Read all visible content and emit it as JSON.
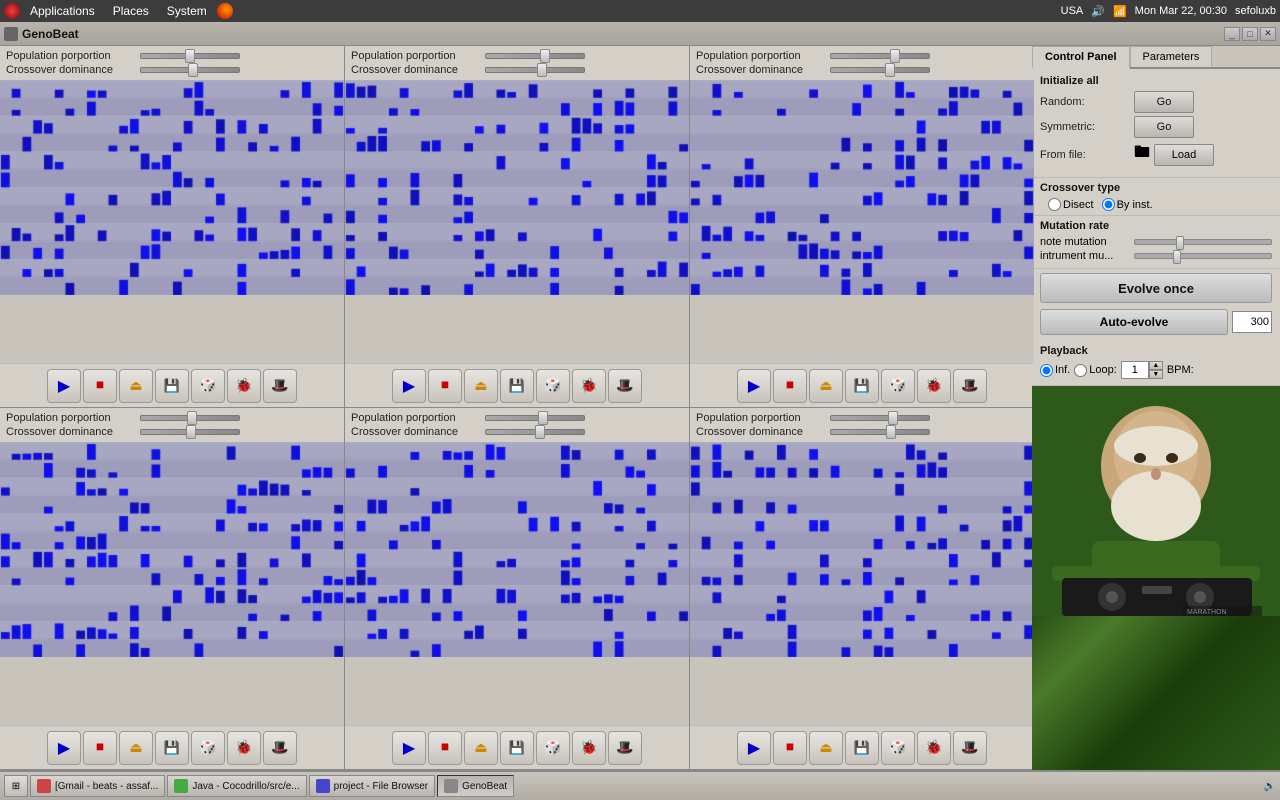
{
  "menubar": {
    "apps_label": "Applications",
    "places_label": "Places",
    "system_label": "System",
    "location": "USA",
    "time": "Mon Mar 22, 00:30",
    "user": "sefoluxb"
  },
  "titlebar": {
    "title": "GenoBeat"
  },
  "win_controls": {
    "minimize": "_",
    "maximize": "□",
    "close": "✕"
  },
  "panels": [
    {
      "id": 1
    },
    {
      "id": 2
    },
    {
      "id": 3
    },
    {
      "id": 4
    },
    {
      "id": 5
    },
    {
      "id": 6
    }
  ],
  "panel_controls": {
    "population_label": "Population porportion",
    "crossover_label": "Crossover dominance"
  },
  "toolbar_buttons": [
    {
      "name": "play",
      "icon": "▶"
    },
    {
      "name": "stop",
      "icon": "⏹"
    },
    {
      "name": "eject",
      "icon": "⏏"
    },
    {
      "name": "save",
      "icon": "💾"
    },
    {
      "name": "dice",
      "icon": "🎲"
    },
    {
      "name": "bug",
      "icon": "🐞"
    },
    {
      "name": "hat",
      "icon": "🎩"
    }
  ],
  "control_panel": {
    "tab1": "Control Panel",
    "tab2": "Parameters",
    "initialize_title": "Initialize all",
    "random_label": "Random:",
    "symmetric_label": "Symmetric:",
    "from_file_label": "From file:",
    "go_label": "Go",
    "load_label": "Load",
    "crossover_title": "Crossover type",
    "disect_label": "Disect",
    "by_inst_label": "By inst.",
    "mutation_title": "Mutation rate",
    "note_mutation_label": "note mutation",
    "instr_mutation_label": "intrument mu...",
    "evolve_once_label": "Evolve once",
    "auto_evolve_label": "Auto-evolve",
    "auto_evolve_val": "300",
    "playback_title": "Playback",
    "inf_label": "Inf.",
    "loop_label": "Loop:",
    "bpm_label": "BPM:",
    "playback_num": "1"
  },
  "taskbar": {
    "items": [
      {
        "label": "[Gmail - beats - assaf...",
        "icon_color": "#c44"
      },
      {
        "label": "Java - Cocodrillo/src/e...",
        "icon_color": "#4a4"
      },
      {
        "label": "project - File Browser",
        "icon_color": "#44c"
      },
      {
        "label": "GenoBeat",
        "icon_color": "#888",
        "active": true
      }
    ]
  }
}
